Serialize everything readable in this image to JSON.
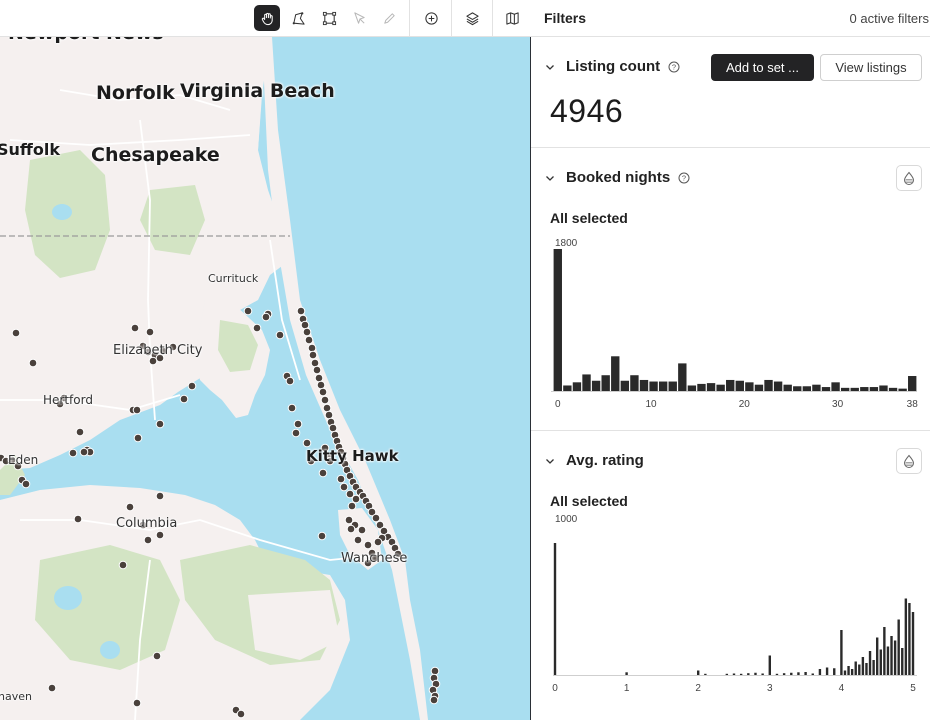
{
  "toolbar": {
    "tools": [
      {
        "name": "pan-tool",
        "icon": "hand-icon",
        "active": true
      },
      {
        "name": "polygon-tool",
        "icon": "lasso-icon"
      },
      {
        "name": "rectangle-tool",
        "icon": "rectangle-select-icon"
      },
      {
        "name": "select-tool",
        "icon": "pointer-icon",
        "disabled": true
      },
      {
        "name": "edit-tool",
        "icon": "pencil-icon",
        "disabled": true
      },
      {
        "name": "add-tool",
        "icon": "plus-circle-icon"
      },
      {
        "name": "layers-tool",
        "icon": "layers-icon"
      },
      {
        "name": "basemap-tool",
        "icon": "map-icon"
      }
    ]
  },
  "map": {
    "labels": {
      "newport_news": "Newport News",
      "norfolk": "Norfolk",
      "virginia_beach": "Virginia Beach",
      "suffolk": "Suffolk",
      "chesapeake": "Chesapeake",
      "currituck": "Currituck",
      "elizabeth_city": "Elizabeth City",
      "hertford": "Hertford",
      "edenton": "Eden",
      "kitty_hawk": "Kitty Hawk",
      "columbia": "Columbia",
      "wanchese": "Wanchese",
      "plymouth": "haven"
    },
    "colors": {
      "water": "#a9def0",
      "land": "#f5f0ef",
      "park": "#d3e4c4",
      "marker": "#4a413c"
    }
  },
  "panel": {
    "title": "Filters",
    "active_filters": "0 active filters",
    "listing_count": {
      "title": "Listing count",
      "value": "4946",
      "add_button": "Add to set ...",
      "view_button": "View listings"
    },
    "booked_nights": {
      "title": "Booked nights",
      "selection": "All selected",
      "ymax_label": "1800",
      "x_ticks": [
        "0",
        "10",
        "20",
        "30",
        "38"
      ]
    },
    "avg_rating": {
      "title": "Avg. rating",
      "selection": "All selected",
      "ymax_label": "1000",
      "x_ticks": [
        "0",
        "1",
        "2",
        "3",
        "4",
        "5"
      ]
    }
  },
  "chart_data": [
    {
      "type": "bar",
      "title": "Booked nights",
      "x_range": [
        0,
        38
      ],
      "ylim": [
        0,
        1800
      ],
      "bin_starts": [
        0,
        1,
        2,
        3,
        4,
        5,
        6,
        7,
        8,
        9,
        10,
        11,
        12,
        13,
        14,
        15,
        16,
        17,
        18,
        19,
        20,
        21,
        22,
        23,
        24,
        25,
        26,
        27,
        28,
        29,
        30,
        31,
        32,
        33,
        34,
        35,
        36,
        37
      ],
      "values": [
        1800,
        70,
        110,
        210,
        130,
        200,
        440,
        130,
        200,
        140,
        120,
        120,
        120,
        350,
        70,
        90,
        100,
        80,
        140,
        130,
        110,
        80,
        140,
        120,
        80,
        60,
        60,
        80,
        50,
        110,
        40,
        40,
        50,
        50,
        70,
        40,
        30,
        190
      ]
    },
    {
      "type": "bar",
      "title": "Avg. rating",
      "x_range": [
        0,
        5
      ],
      "ylim": [
        0,
        1000
      ],
      "bins": [
        [
          0.0,
          880
        ],
        [
          1.0,
          18
        ],
        [
          2.0,
          30
        ],
        [
          2.1,
          5
        ],
        [
          2.4,
          8
        ],
        [
          2.5,
          10
        ],
        [
          2.6,
          8
        ],
        [
          2.7,
          12
        ],
        [
          2.8,
          15
        ],
        [
          2.9,
          10
        ],
        [
          3.0,
          130
        ],
        [
          3.1,
          8
        ],
        [
          3.2,
          12
        ],
        [
          3.3,
          15
        ],
        [
          3.4,
          18
        ],
        [
          3.5,
          20
        ],
        [
          3.6,
          10
        ],
        [
          3.7,
          40
        ],
        [
          3.8,
          50
        ],
        [
          3.9,
          45
        ],
        [
          4.0,
          300
        ],
        [
          4.05,
          30
        ],
        [
          4.1,
          60
        ],
        [
          4.15,
          40
        ],
        [
          4.2,
          90
        ],
        [
          4.25,
          70
        ],
        [
          4.3,
          120
        ],
        [
          4.35,
          80
        ],
        [
          4.4,
          160
        ],
        [
          4.45,
          100
        ],
        [
          4.5,
          250
        ],
        [
          4.55,
          170
        ],
        [
          4.6,
          320
        ],
        [
          4.65,
          190
        ],
        [
          4.7,
          260
        ],
        [
          4.75,
          230
        ],
        [
          4.8,
          370
        ],
        [
          4.85,
          180
        ],
        [
          4.9,
          510
        ],
        [
          4.95,
          480
        ],
        [
          5.0,
          420
        ]
      ]
    }
  ]
}
